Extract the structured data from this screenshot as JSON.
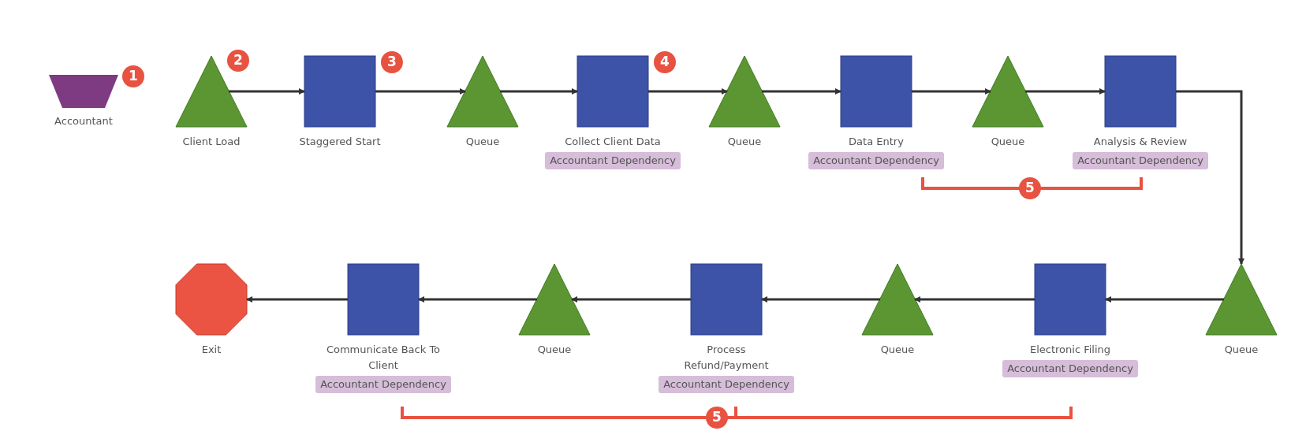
{
  "top_row": [
    {
      "kind": "operator",
      "label": "Accountant",
      "badge": "1"
    },
    {
      "kind": "queue",
      "label": "Client Load",
      "badge": "2"
    },
    {
      "kind": "process",
      "label": "Staggered Start",
      "badge": "3"
    },
    {
      "kind": "queue",
      "label": "Queue"
    },
    {
      "kind": "process",
      "label": "Collect Client Data",
      "tag": "Accountant Dependency",
      "badge": "4"
    },
    {
      "kind": "queue",
      "label": "Queue"
    },
    {
      "kind": "process",
      "label": "Data Entry",
      "tag": "Accountant Dependency"
    },
    {
      "kind": "queue",
      "label": "Queue"
    },
    {
      "kind": "process",
      "label": "Analysis & Review",
      "tag": "Accountant Dependency"
    }
  ],
  "bottom_row": [
    {
      "kind": "exit",
      "label": "Exit"
    },
    {
      "kind": "process",
      "label": "Communicate Back To Client",
      "tag": "Accountant Dependency"
    },
    {
      "kind": "queue",
      "label": "Queue"
    },
    {
      "kind": "process",
      "label": "Process Refund/Payment",
      "tag": "Accountant Dependency"
    },
    {
      "kind": "queue",
      "label": "Queue"
    },
    {
      "kind": "process",
      "label": "Electronic Filing",
      "tag": "Accountant Dependency"
    },
    {
      "kind": "queue",
      "label": "Queue"
    }
  ],
  "brackets": [
    {
      "badge": "5"
    },
    {
      "badge": "5"
    }
  ]
}
